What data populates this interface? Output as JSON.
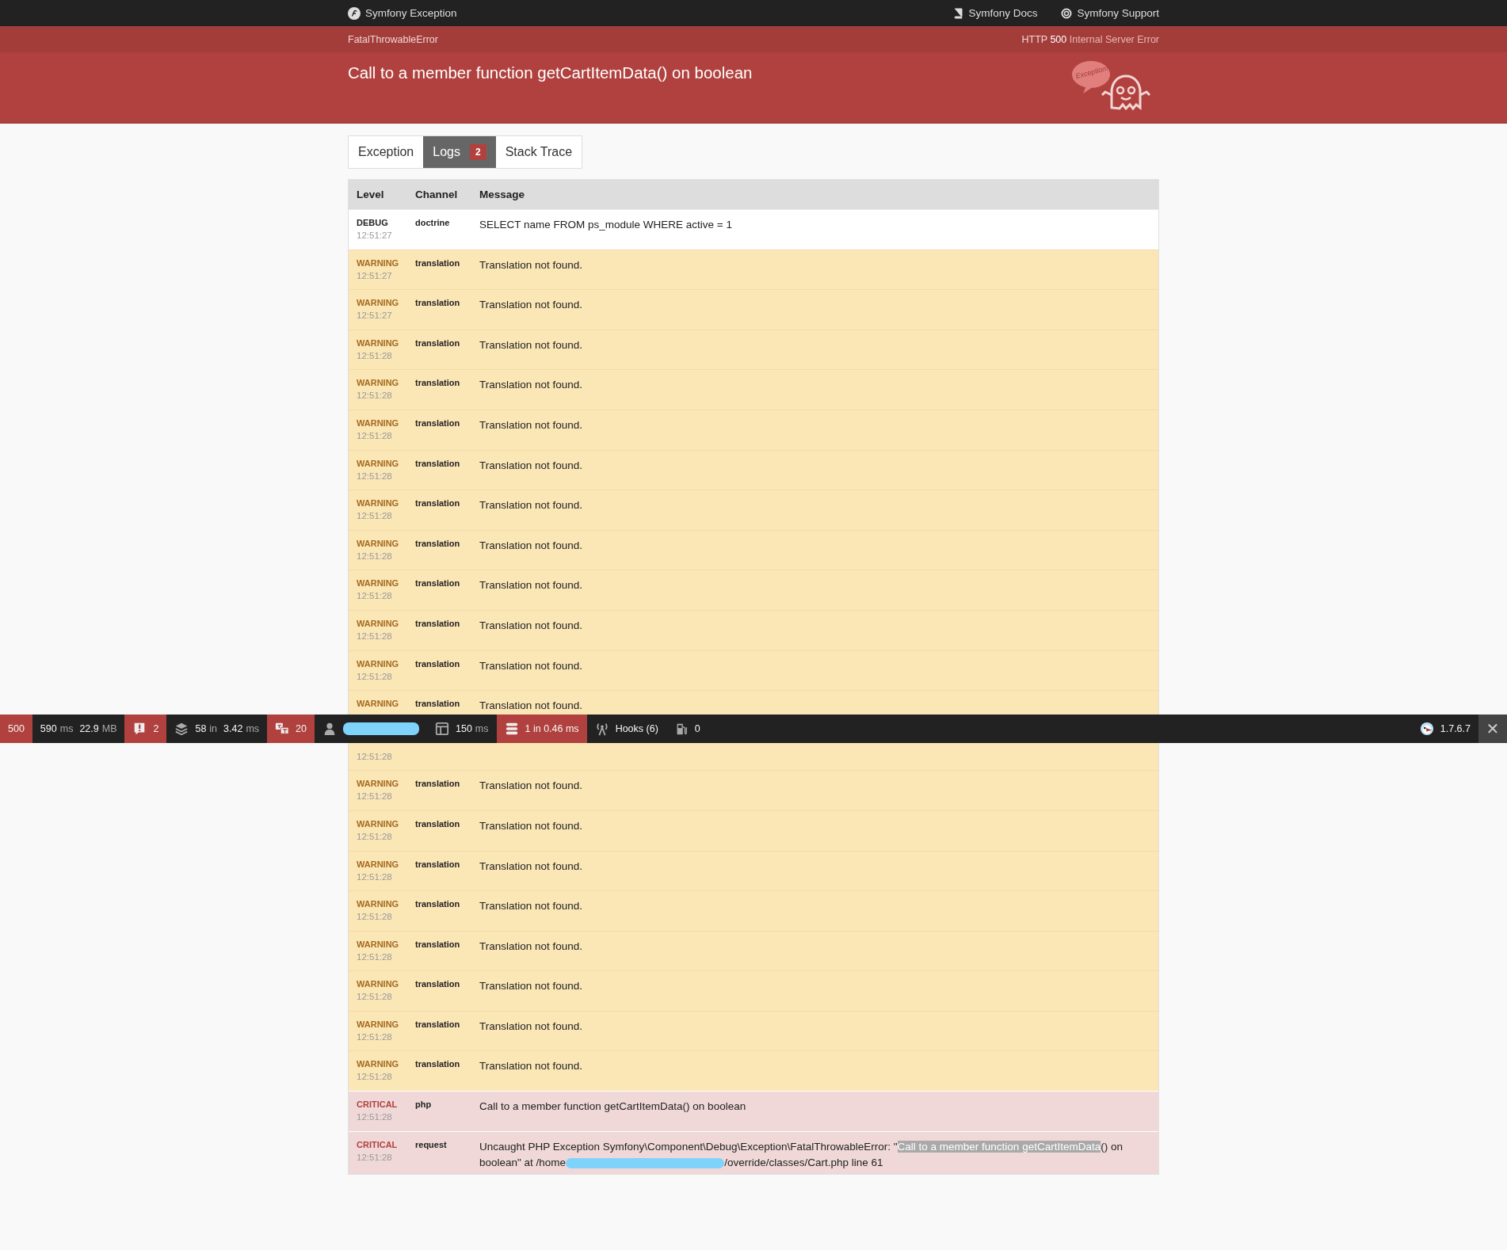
{
  "topbar": {
    "title": "Symfony Exception",
    "links": [
      "Symfony Docs",
      "Symfony Support"
    ]
  },
  "summary": {
    "exception_class": "FatalThrowableError",
    "status_label": "HTTP",
    "status_code": "500",
    "status_text": "Internal Server Error",
    "message": "Call to a member function getCartItemData() on boolean",
    "logo_text": "Exception!"
  },
  "tabs": [
    {
      "label": "Exception",
      "selected": false
    },
    {
      "label": "Logs",
      "selected": true,
      "badge": "2"
    },
    {
      "label": "Stack Trace",
      "selected": false
    }
  ],
  "table": {
    "columns": [
      "Level",
      "Channel",
      "Message"
    ],
    "rows": [
      {
        "kind": "debug",
        "level": "DEBUG",
        "time": "12:51:27",
        "channel": "doctrine",
        "message": [
          {
            "kind": "text",
            "text": "SELECT name FROM ps_module WHERE active = 1"
          }
        ]
      },
      {
        "kind": "warning",
        "level": "WARNING",
        "time": "12:51:27",
        "channel": "translation",
        "message": [
          {
            "kind": "text",
            "text": "Translation not found."
          }
        ]
      },
      {
        "kind": "warning",
        "level": "WARNING",
        "time": "12:51:27",
        "channel": "translation",
        "message": [
          {
            "kind": "text",
            "text": "Translation not found."
          }
        ]
      },
      {
        "kind": "warning",
        "level": "WARNING",
        "time": "12:51:28",
        "channel": "translation",
        "message": [
          {
            "kind": "text",
            "text": "Translation not found."
          }
        ]
      },
      {
        "kind": "warning",
        "level": "WARNING",
        "time": "12:51:28",
        "channel": "translation",
        "message": [
          {
            "kind": "text",
            "text": "Translation not found."
          }
        ]
      },
      {
        "kind": "warning",
        "level": "WARNING",
        "time": "12:51:28",
        "channel": "translation",
        "message": [
          {
            "kind": "text",
            "text": "Translation not found."
          }
        ]
      },
      {
        "kind": "warning",
        "level": "WARNING",
        "time": "12:51:28",
        "channel": "translation",
        "message": [
          {
            "kind": "text",
            "text": "Translation not found."
          }
        ]
      },
      {
        "kind": "warning",
        "level": "WARNING",
        "time": "12:51:28",
        "channel": "translation",
        "message": [
          {
            "kind": "text",
            "text": "Translation not found."
          }
        ]
      },
      {
        "kind": "warning",
        "level": "WARNING",
        "time": "12:51:28",
        "channel": "translation",
        "message": [
          {
            "kind": "text",
            "text": "Translation not found."
          }
        ]
      },
      {
        "kind": "warning",
        "level": "WARNING",
        "time": "12:51:28",
        "channel": "translation",
        "message": [
          {
            "kind": "text",
            "text": "Translation not found."
          }
        ]
      },
      {
        "kind": "warning",
        "level": "WARNING",
        "time": "12:51:28",
        "channel": "translation",
        "message": [
          {
            "kind": "text",
            "text": "Translation not found."
          }
        ]
      },
      {
        "kind": "warning",
        "level": "WARNING",
        "time": "12:51:28",
        "channel": "translation",
        "message": [
          {
            "kind": "text",
            "text": "Translation not found."
          }
        ]
      },
      {
        "kind": "warning",
        "level": "WARNING",
        "channel": "translation",
        "message": [
          {
            "kind": "text",
            "text": "Translation not found."
          }
        ]
      },
      {
        "kind": "warning",
        "time": "12:51:28"
      },
      {
        "kind": "warning",
        "level": "WARNING",
        "time": "12:51:28",
        "channel": "translation",
        "message": [
          {
            "kind": "text",
            "text": "Translation not found."
          }
        ]
      },
      {
        "kind": "warning",
        "level": "WARNING",
        "time": "12:51:28",
        "channel": "translation",
        "message": [
          {
            "kind": "text",
            "text": "Translation not found."
          }
        ]
      },
      {
        "kind": "warning",
        "level": "WARNING",
        "time": "12:51:28",
        "channel": "translation",
        "message": [
          {
            "kind": "text",
            "text": "Translation not found."
          }
        ]
      },
      {
        "kind": "warning",
        "level": "WARNING",
        "time": "12:51:28",
        "channel": "translation",
        "message": [
          {
            "kind": "text",
            "text": "Translation not found."
          }
        ]
      },
      {
        "kind": "warning",
        "level": "WARNING",
        "time": "12:51:28",
        "channel": "translation",
        "message": [
          {
            "kind": "text",
            "text": "Translation not found."
          }
        ]
      },
      {
        "kind": "warning",
        "level": "WARNING",
        "time": "12:51:28",
        "channel": "translation",
        "message": [
          {
            "kind": "text",
            "text": "Translation not found."
          }
        ]
      },
      {
        "kind": "warning",
        "level": "WARNING",
        "time": "12:51:28",
        "channel": "translation",
        "message": [
          {
            "kind": "text",
            "text": "Translation not found."
          }
        ]
      },
      {
        "kind": "warning",
        "level": "WARNING",
        "time": "12:51:28",
        "channel": "translation",
        "message": [
          {
            "kind": "text",
            "text": "Translation not found."
          }
        ]
      },
      {
        "kind": "critical",
        "level": "CRITICAL",
        "time": "12:51:28",
        "channel": "php",
        "message": [
          {
            "kind": "text",
            "text": "Call to a member function getCartItemData() on boolean"
          }
        ]
      },
      {
        "kind": "critical",
        "level": "CRITICAL",
        "time": "12:51:28",
        "channel": "request",
        "message": [
          {
            "kind": "text",
            "text": "Uncaught PHP Exception Symfony\\Component\\Debug\\Exception\\FatalThrowableError: \""
          },
          {
            "kind": "selected",
            "text": "Call to a member function getCartItemData"
          },
          {
            "kind": "text",
            "text": "() on boolean\" at /home"
          },
          {
            "kind": "redacted"
          },
          {
            "kind": "text",
            "text": "/override/classes/Cart.php line 61"
          }
        ]
      }
    ]
  },
  "toolbar": {
    "items": [
      {
        "kind": "status",
        "alert": true,
        "values": [
          {
            "value": "500"
          }
        ]
      },
      {
        "kind": "perf",
        "alert": false,
        "values": [
          {
            "value": "590",
            "unit": "ms"
          },
          {
            "value": "22.9",
            "unit": "MB"
          }
        ]
      },
      {
        "kind": "errors",
        "alert": true,
        "values": [
          {
            "value": "2"
          }
        ]
      },
      {
        "kind": "layers",
        "alert": false,
        "values": [
          {
            "value": "58",
            "unit": "in"
          },
          {
            "value": "3.42",
            "unit": "ms"
          }
        ]
      },
      {
        "kind": "translation",
        "alert": true,
        "values": [
          {
            "value": "20"
          }
        ]
      },
      {
        "kind": "user",
        "alert": false
      },
      {
        "kind": "layout",
        "alert": false,
        "values": [
          {
            "value": "150",
            "unit": "ms"
          }
        ]
      },
      {
        "kind": "database",
        "alert": true,
        "values": [
          {
            "value": "1 in 0.46 ms"
          }
        ]
      },
      {
        "kind": "hooks",
        "alert": false,
        "values": [
          {
            "value": "Hooks (6)"
          }
        ]
      },
      {
        "kind": "fuel",
        "alert": false,
        "values": [
          {
            "value": "0"
          }
        ]
      }
    ],
    "version": "1.7.6.7",
    "close": "✕"
  }
}
